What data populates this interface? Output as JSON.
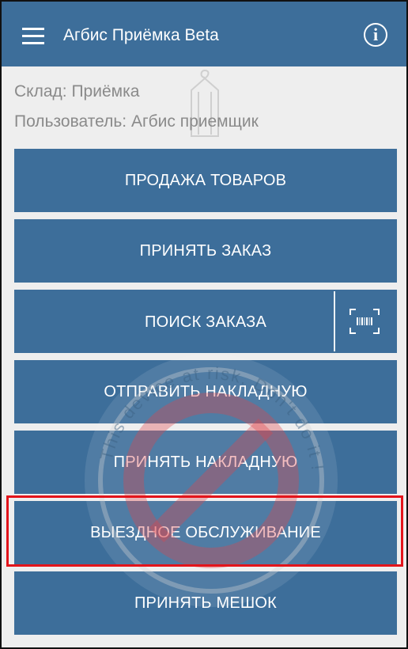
{
  "appbar": {
    "title": "Агбис Приёмка Beta",
    "menu_icon": "hamburger-menu-icon",
    "info_icon": "info-icon"
  },
  "info": {
    "warehouse": "Склад: Приёмка",
    "user": "Пользователь: Агбис приемщик"
  },
  "buttons": [
    {
      "label": "ПРОДАЖА ТОВАРОВ"
    },
    {
      "label": "ПРИНЯТЬ ЗАКАЗ"
    },
    {
      "label": "ПОИСК ЗАКАЗА",
      "icon": "barcode-scan-icon"
    },
    {
      "label": "ОТПРАВИТЬ НАКЛАДНУЮ"
    },
    {
      "label": "ПРИНЯТЬ НАКЛАДНУЮ"
    },
    {
      "label": "ВЫЕЗДНОЕ ОБСЛУЖИВАНИЕ"
    },
    {
      "label": "ПРИНЯТЬ МЕШОК"
    }
  ],
  "watermark": {
    "text": "This device at risk. Don't do it !",
    "icon": "prohibited-icon"
  },
  "colors": {
    "primary": "#3d6e9a",
    "highlight": "#e3141b",
    "background": "#eeeeee"
  }
}
